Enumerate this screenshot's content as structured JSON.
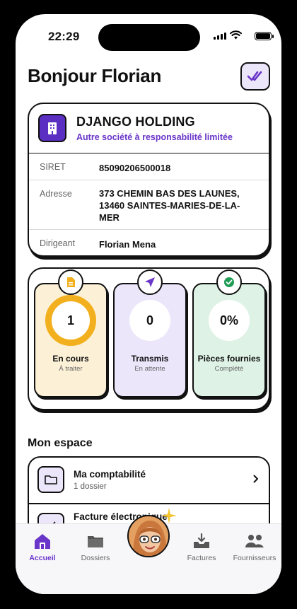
{
  "status": {
    "time": "22:29"
  },
  "header": {
    "greeting": "Bonjour Florian",
    "action_icon": "double-check-icon"
  },
  "company": {
    "name": "DJANGO HOLDING",
    "type": "Autre société à responsabilité limitée",
    "rows": [
      {
        "label": "SIRET",
        "value": "85090206500018"
      },
      {
        "label": "Adresse",
        "value": "373 CHEMIN BAS DES LAUNES, 13460 SAINTES-MARIES-DE-LA-MER"
      },
      {
        "label": "Dirigeant",
        "value": "Florian Mena"
      }
    ]
  },
  "stats": [
    {
      "value": "1",
      "label": "En cours",
      "sub": "À traiter",
      "icon": "document-icon",
      "color": "#f2b01e"
    },
    {
      "value": "0",
      "label": "Transmis",
      "sub": "En attente",
      "icon": "send-icon",
      "color": "#6a35c9"
    },
    {
      "value": "0%",
      "label": "Pièces fournies",
      "sub": "Complété",
      "icon": "check-circle-icon",
      "color": "#1f9d55"
    }
  ],
  "space": {
    "title": "Mon espace",
    "items": [
      {
        "title": "Ma comptabilité",
        "sub": "1 dossier",
        "icon": "folder-icon"
      },
      {
        "title": "Facture électronique",
        "sub": "",
        "icon": "invoice-icon"
      }
    ]
  },
  "tabs": [
    {
      "label": "Accueil",
      "icon": "home-icon",
      "active": true
    },
    {
      "label": "Dossiers",
      "icon": "folder-icon",
      "active": false
    },
    {
      "label": "",
      "icon": "assistant-avatar",
      "active": false
    },
    {
      "label": "Factures",
      "icon": "inbox-download-icon",
      "active": false
    },
    {
      "label": "Fournisseurs",
      "icon": "users-icon",
      "active": false
    }
  ],
  "colors": {
    "accent": "#6a35c9",
    "yellow": "#f2b01e",
    "green": "#1f9d55"
  }
}
